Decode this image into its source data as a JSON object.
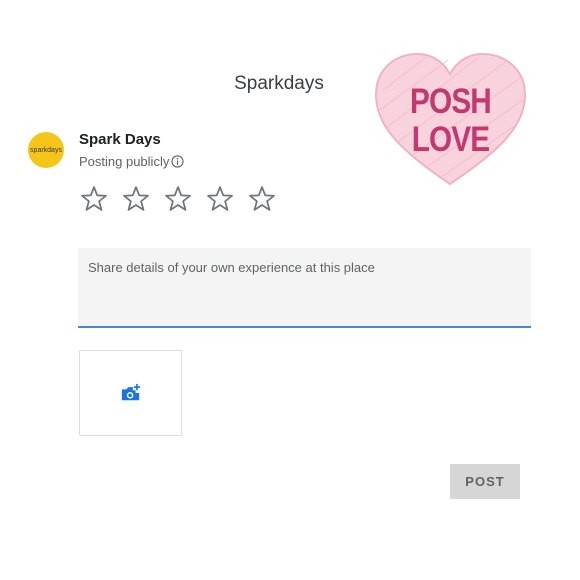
{
  "header": {
    "title": "Sparkdays"
  },
  "sticker": {
    "line1": "POSH",
    "line2": "LOVE",
    "heart_color": "#f6c6d3",
    "text_color": "#c4386f"
  },
  "user": {
    "avatar_text": "sparkdays",
    "name": "Spark Days",
    "posting_status": "Posting publicly",
    "avatar_color": "#f5c518"
  },
  "rating": {
    "max_stars": 5,
    "selected": 0
  },
  "review": {
    "placeholder": "Share details of your own experience at this place",
    "value": ""
  },
  "actions": {
    "post_label": "POST"
  },
  "colors": {
    "accent": "#4a86d4",
    "photo_icon": "#1a73e8"
  }
}
